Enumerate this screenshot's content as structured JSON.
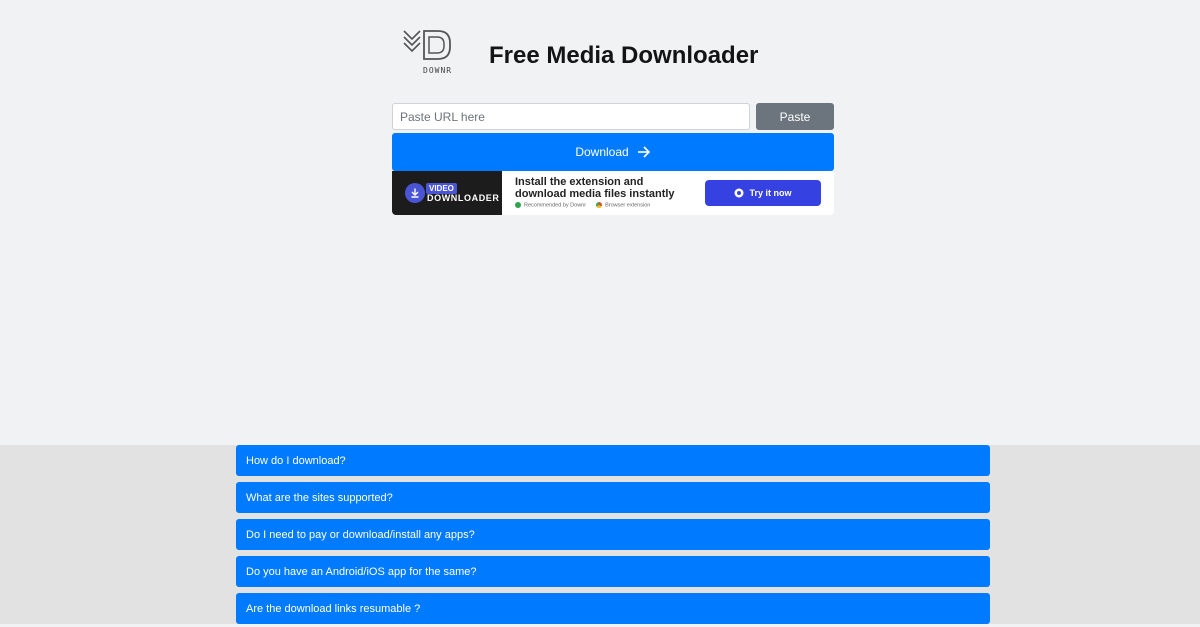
{
  "header": {
    "logo_text": "DOWNR",
    "title": "Free Media Downloader"
  },
  "form": {
    "url_placeholder": "Paste URL here",
    "paste_label": "Paste",
    "download_label": "Download"
  },
  "ad": {
    "badge_line1": "VIDEO",
    "badge_line2": "DOWNLOADER",
    "headline": "Install the extension and download media files instantly",
    "recommended": "Recommended by Downr",
    "extension_note": "Browser extension",
    "cta_label": "Try it now"
  },
  "faq": {
    "items": [
      "How do I download?",
      "What are the sites supported?",
      "Do I need to pay or download/install any apps?",
      "Do you have an Android/iOS app for the same?",
      "Are the download links resumable ?"
    ]
  },
  "colors": {
    "primary": "#007bff",
    "secondary": "#6c757d",
    "ad_cta": "#3541e0",
    "page_bg": "#f1f2f4",
    "faq_bg": "#e2e2e2"
  }
}
